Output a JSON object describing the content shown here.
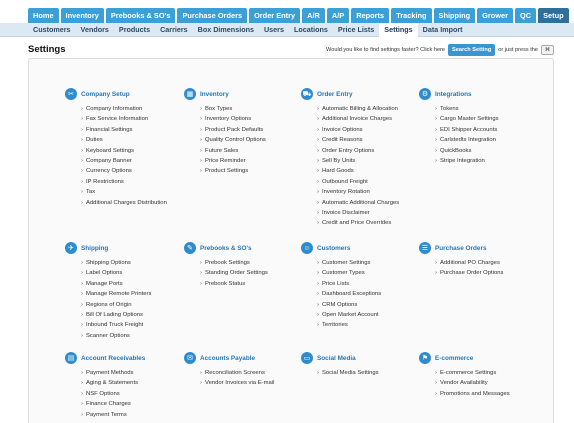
{
  "nav": {
    "tabs": [
      "Home",
      "Inventory",
      "Prebooks & SO's",
      "Purchase Orders",
      "Order Entry",
      "A/R",
      "A/P",
      "Reports",
      "Tracking",
      "Shipping",
      "Grower",
      "QC",
      "Setup"
    ],
    "active_tab": "Setup",
    "subtabs": [
      "Customers",
      "Vendors",
      "Products",
      "Carriers",
      "Box Dimensions",
      "Users",
      "Locations",
      "Price Lists",
      "Settings",
      "Data Import"
    ],
    "active_subtab": "Settings"
  },
  "page": {
    "title": "Settings",
    "find_prompt": "Would you like to find settings faster? Click here",
    "find_button": "Search Setting",
    "find_suffix": "or just press the",
    "find_key": "⌘"
  },
  "sections": [
    {
      "title": "Company Setup",
      "icon": "✂",
      "items": [
        "Company Information",
        "Fax Service Information",
        "Financial Settings",
        "Duties",
        "Keyboard Settings",
        "Company Banner",
        "Currency Options",
        "IP Restrictions",
        "Tax",
        "Additional Charges Distribution"
      ]
    },
    {
      "title": "Inventory",
      "icon": "▦",
      "items": [
        "Box Types",
        "Inventory Options",
        "Product Pack Defaults",
        "Quality Control Options",
        "Future Sales",
        "Price Reminder",
        "Product Settings"
      ]
    },
    {
      "title": "Order Entry",
      "icon": "⛟",
      "items": [
        "Automatic Billing & Allocation",
        "Additional Invoice Charges",
        "Invoice Options",
        "Credit Reasons",
        "Order Entry Options",
        "Sell By Units",
        "Hard Goods",
        "Outbound Freight",
        "Inventory Rotation",
        "Automatic Additional Charges",
        "Invoice Disclaimer",
        "Credit and Price Overrides"
      ]
    },
    {
      "title": "Integrations",
      "icon": "⚙",
      "items": [
        "Tokens",
        "Cargo Master Settings",
        "EDI Shipper Accounts",
        "Carlstedts Integration",
        "QuickBooks",
        "Stripe Integration"
      ]
    },
    {
      "title": "Shipping",
      "icon": "✈",
      "items": [
        "Shipping Options",
        "Label Options",
        "Manage Ports",
        "Manage Remote Printers",
        "Regions of Origin",
        "Bill Of Lading Options",
        "Inbound Truck Freight",
        "Scanner Options"
      ]
    },
    {
      "title": "Prebooks & SO's",
      "icon": "✎",
      "items": [
        "Prebook Settings",
        "Standing Order Settings",
        "Prebook Status"
      ]
    },
    {
      "title": "Customers",
      "icon": "☺",
      "items": [
        "Customer Settings",
        "Customer Types",
        "Price Lists",
        "Dashboard Exceptions",
        "CRM Options",
        "Open Market Account",
        "Territories"
      ]
    },
    {
      "title": "Purchase Orders",
      "icon": "☰",
      "items": [
        "Additional PO Charges",
        "Purchase Order Options"
      ]
    },
    {
      "title": "Account Receivables",
      "icon": "▤",
      "items": [
        "Payment Methods",
        "Aging & Statements",
        "NSF Options",
        "Finance Charges",
        "Payment Terms"
      ]
    },
    {
      "title": "Accounts Payable",
      "icon": "✉",
      "items": [
        "Reconciliation Screens",
        "Vendor Invoices via E-mail"
      ]
    },
    {
      "title": "Social Media",
      "icon": "▭",
      "items": [
        "Social Media Settings"
      ]
    },
    {
      "title": "E-commerce",
      "icon": "⚑",
      "items": [
        "E-commerce Settings",
        "Vendor Availability",
        "Promotions and Messages"
      ]
    }
  ]
}
